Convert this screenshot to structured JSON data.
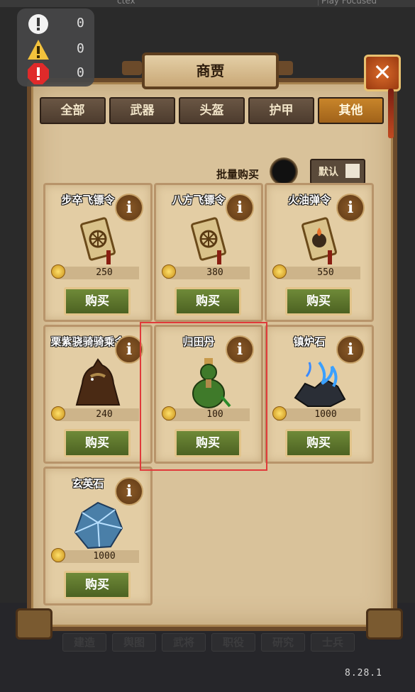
{
  "editor": {
    "tab_left": "ctex",
    "tab_right": "Play Focused"
  },
  "status_panel": {
    "items": [
      {
        "icon": "info-circle-icon",
        "count": "0",
        "color": "#f2f2f2"
      },
      {
        "icon": "warning-triangle-icon",
        "count": "0",
        "color": "#f3c23c"
      },
      {
        "icon": "error-octagon-icon",
        "count": "0",
        "color": "#e02a2a"
      }
    ]
  },
  "window": {
    "title": "商贾",
    "close_glyph": "✕"
  },
  "tabs": [
    {
      "label": "全部",
      "active": false
    },
    {
      "label": "武器",
      "active": false
    },
    {
      "label": "头盔",
      "active": false
    },
    {
      "label": "护甲",
      "active": false
    },
    {
      "label": "其他",
      "active": true
    }
  ],
  "batch": {
    "label": "批量购买",
    "default_label": "默认"
  },
  "items": [
    {
      "name": "步卒飞镖令",
      "price": "250",
      "buy": "购买",
      "icon": "token-scroll-icon"
    },
    {
      "name": "八方飞镖令",
      "price": "380",
      "buy": "购买",
      "icon": "token-scroll-icon"
    },
    {
      "name": "火油弹令",
      "price": "550",
      "buy": "购买",
      "icon": "fire-token-icon"
    },
    {
      "name": "栗紫骁骑骑乘令",
      "price": "240",
      "buy": "购买",
      "icon": "horse-icon"
    },
    {
      "name": "归田丹",
      "price": "100",
      "buy": "购买",
      "icon": "potion-gourd-icon"
    },
    {
      "name": "镇炉石",
      "price": "1000",
      "buy": "购买",
      "icon": "ore-blue-fire-icon"
    },
    {
      "name": "玄英石",
      "price": "1000",
      "buy": "购买",
      "icon": "crystal-ore-icon"
    }
  ],
  "info_glyph": "i",
  "bottom_nav": [
    "建造",
    "舆图",
    "武将",
    "职役",
    "研究",
    "士兵"
  ],
  "version": "8.28.1",
  "colors": {
    "panel": "#d9c29a",
    "active_tab": "#c8852a",
    "buy_button": "#5c7a2c",
    "highlight": "#e03a3a"
  }
}
